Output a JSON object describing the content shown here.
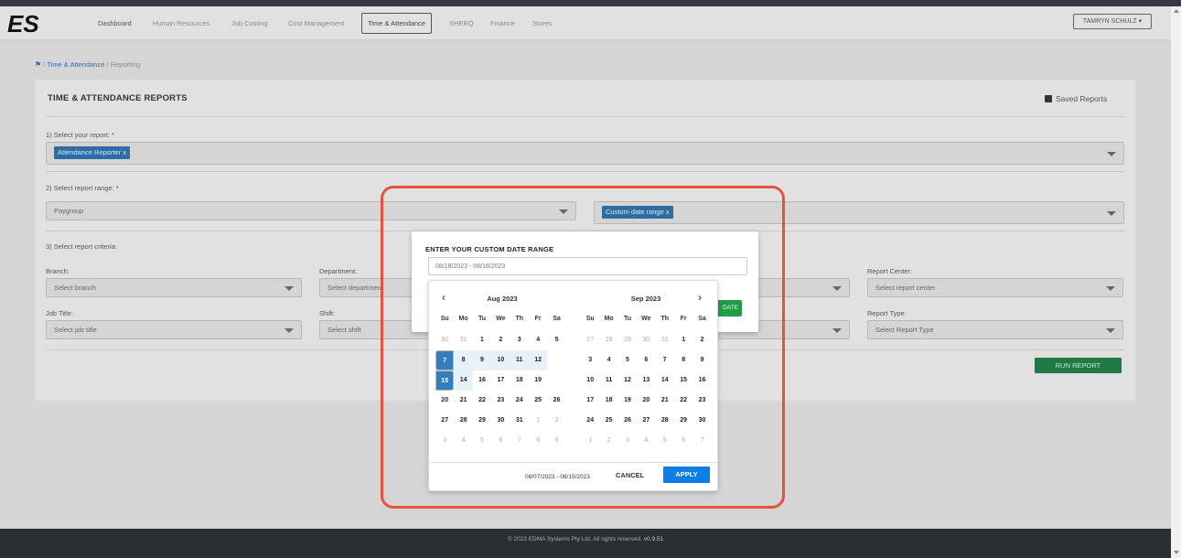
{
  "app": {
    "logo_text": "ES",
    "user": "TAMRYN SCHULZ ▾"
  },
  "nav": [
    {
      "label": "Dashboard"
    },
    {
      "label": "Human Resources"
    },
    {
      "label": "Job Costing"
    },
    {
      "label": "Cost Management"
    },
    {
      "label": "Time & Attendance"
    },
    {
      "label": "SHERQ"
    },
    {
      "label": "Finance"
    },
    {
      "label": "Stores"
    }
  ],
  "breadcrumb": {
    "home_icon": "home-icon",
    "sep1": "/",
    "link": "Time & Attendance",
    "sep2": "/",
    "current": "Reporting"
  },
  "page": {
    "title": "TIME & ATTENDANCE REPORTS",
    "saved_reports": "Saved Reports",
    "step1_label": "1) Select your report: *",
    "step1_tag": "Attendance Reporter x",
    "step2_label": "2) Select report range: *",
    "range_value": "Paygroup",
    "range_tag": "Custom date range x",
    "step3_label": "3) Select report criteria:",
    "criteria": {
      "branch_label": "Branch:",
      "branch_ph": "Select branch",
      "department_label": "Department:",
      "department_ph": "Select department",
      "report_center_label": "Report Center:",
      "report_center_ph": "Select report center",
      "job_title_label": "Job Title:",
      "job_title_ph": "Select job title",
      "shift_label": "Shift:",
      "shift_ph": "Select shift",
      "report_type_label": "Report Type:",
      "report_type_ph": "Select Report Type"
    },
    "run_report": "RUN REPORT"
  },
  "modal": {
    "title": "ENTER YOUR CUSTOM DATE RANGE",
    "input_value": "08/18/2023 - 08/18/2023",
    "update_btn": "DATE"
  },
  "datepicker": {
    "prev": "‹",
    "next": "›",
    "weekdays": [
      "Su",
      "Mo",
      "Tu",
      "We",
      "Th",
      "Fr",
      "Sa"
    ],
    "left_month": {
      "title": "Aug 2023",
      "weeks": [
        [
          "30",
          "31",
          "1",
          "2",
          "3",
          "4",
          "5"
        ],
        [
          "6",
          "7",
          "8",
          "9",
          "10",
          "11",
          "12"
        ],
        [
          "13",
          "14",
          "15",
          "16",
          "17",
          "18",
          "19"
        ],
        [
          "20",
          "21",
          "22",
          "23",
          "24",
          "25",
          "26"
        ],
        [
          "27",
          "28",
          "29",
          "30",
          "31",
          "1",
          "2"
        ],
        [
          "3",
          "4",
          "5",
          "6",
          "7",
          "8",
          "9"
        ]
      ]
    },
    "right_month": {
      "title": "Sep 2023",
      "weeks": [
        [
          "27",
          "28",
          "29",
          "30",
          "31",
          "1",
          "2"
        ],
        [
          "3",
          "4",
          "5",
          "6",
          "7",
          "8",
          "9"
        ],
        [
          "10",
          "11",
          "12",
          "13",
          "14",
          "15",
          "16"
        ],
        [
          "17",
          "18",
          "19",
          "20",
          "21",
          "22",
          "23"
        ],
        [
          "24",
          "25",
          "26",
          "27",
          "28",
          "29",
          "30"
        ],
        [
          "1",
          "2",
          "3",
          "4",
          "5",
          "6",
          "7"
        ]
      ]
    },
    "selected_range": "08/07/2023 - 08/15/2023",
    "cancel": "CANCEL",
    "apply": "APPLY"
  },
  "footer": {
    "text": "© 2023 EDMA Systems Pty Ltd. All rights reserved. ",
    "version": "v0.9.51"
  },
  "colors": {
    "accent": "#2d6da3",
    "apply": "#0d7de7",
    "highlight": "#e4533d",
    "run": "#1f7a43"
  }
}
